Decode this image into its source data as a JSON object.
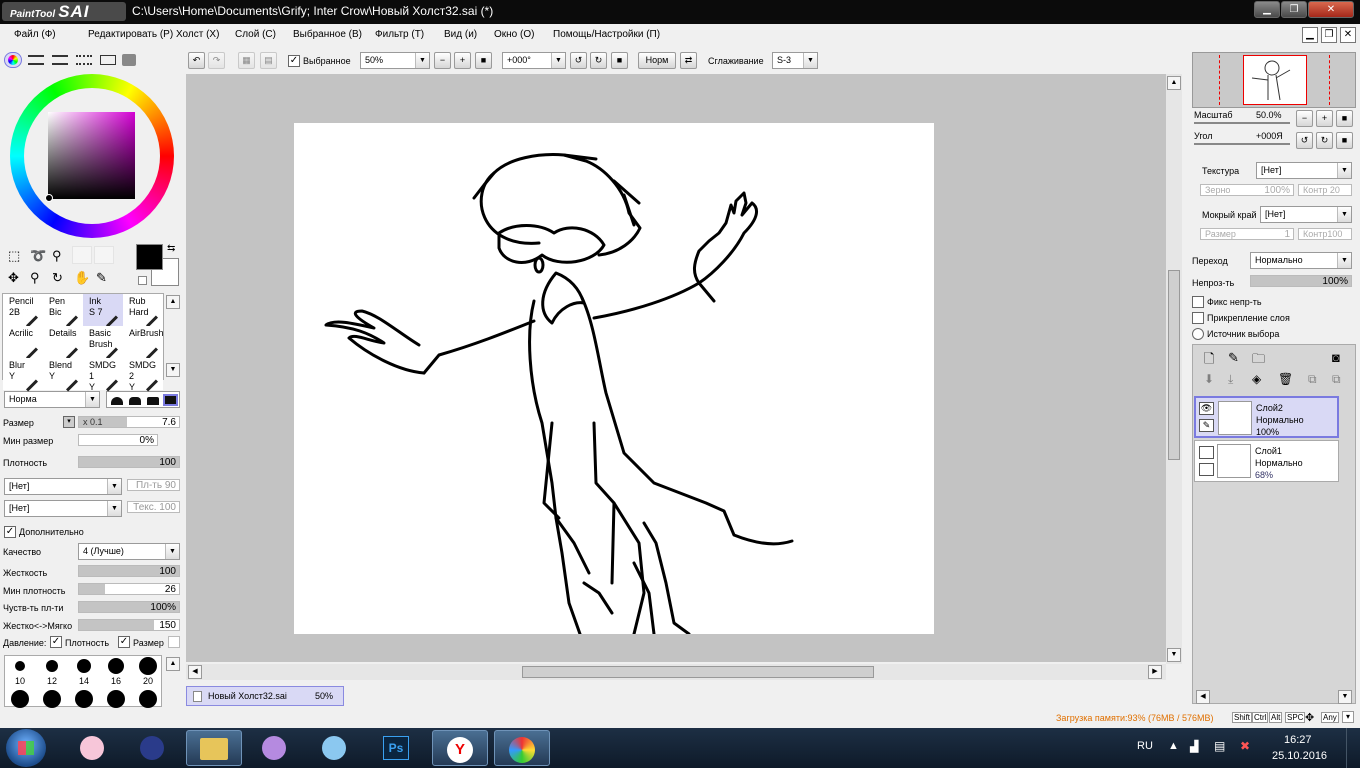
{
  "app": {
    "logo": "PaintTool SAI",
    "logo_small": "PaintTool",
    "logo_big": "SAI",
    "title": "C:\\Users\\Home\\Documents\\Grify; Inter Crow\\Новый Холст32.sai (*)"
  },
  "menu": [
    "Файл (Ф)",
    "Редактировать (Р)",
    "Холст (Х)",
    "Слой (С)",
    "Выбранное (В)",
    "Фильтр (Т)",
    "Вид (и)",
    "Окно (О)",
    "Помощь/Настройки (П)"
  ],
  "toolbar": {
    "selected_label": "Выбранное",
    "zoom": "50%",
    "angle": "+000°",
    "blend": "Норм",
    "smooth_label": "Сглаживание",
    "smooth_value": "S-3"
  },
  "colors": {
    "selected_color": "#000000",
    "secondary_color": "#ffffff",
    "accent": "#d9d9f5"
  },
  "tools": [
    {
      "line1": "Pencil",
      "line2": "2B"
    },
    {
      "line1": "Pen",
      "line2": "Bic"
    },
    {
      "line1": "Ink",
      "line2": "S 7"
    },
    {
      "line1": "Rub",
      "line2": "Hard"
    },
    {
      "line1": "Acrilic",
      "line2": ""
    },
    {
      "line1": "Details",
      "line2": ""
    },
    {
      "line1": "Basic",
      "line2": "Brush"
    },
    {
      "line1": "AirBrush",
      "line2": ""
    },
    {
      "line1": "Blur",
      "line2": "Y"
    },
    {
      "line1": "Blend",
      "line2": "Y"
    },
    {
      "line1": "SMDG 1",
      "line2": "Y"
    },
    {
      "line1": "SMDG 2",
      "line2": "Y"
    }
  ],
  "brush": {
    "mode": "Норма",
    "size_label": "Размер",
    "size_mult": "x 0.1",
    "size_value": "7.6",
    "min_size_label": "Мин размер",
    "min_size_value": "0%",
    "density_label": "Плотность",
    "density_value": "100",
    "tex1": "[Нет]",
    "tex1_side": "Пл-ть 90",
    "tex2": "[Нет]",
    "tex2_side": "Текс. 100",
    "advanced_label": "Дополнительно",
    "quality_label": "Качество",
    "quality_value": "4 (Лучше)",
    "hardness_label": "Жесткость",
    "hardness_value": "100",
    "min_density_label": "Мин плотность",
    "min_density_value": "26",
    "pressure_sense_label": "Чуств-ть пл-ти",
    "pressure_sense_value": "100%",
    "hard_soft_label": "Жестко<->Мягко",
    "hard_soft_value": "150",
    "pressure_label": "Давление:",
    "pressure_density": "Плотность",
    "pressure_size": "Размер"
  },
  "brush_sizes": [
    "10",
    "12",
    "14",
    "16",
    "20"
  ],
  "doc_tab": {
    "name": "Новый Холст32.sai",
    "zoom": "50%"
  },
  "navigator": {
    "zoom_label": "Масштаб",
    "zoom_value": "50.0%",
    "angle_label": "Угол",
    "angle_value": "+000Я"
  },
  "layer_props": {
    "texture_label": "Текстура",
    "texture_value": "[Нет]",
    "grain_label": "Зерно",
    "grain_value": "100%",
    "contrast_label": "Контр 20",
    "wet_label": "Мокрый край",
    "wet_value": "[Нет]",
    "wet_size_label": "Размер",
    "wet_size_value": "1",
    "wet_contrast_label": "Контр100",
    "blend_label": "Переход",
    "blend_value": "Нормально",
    "opacity_label": "Непроз-ть",
    "opacity_value": "100%",
    "fix_opacity": "Фикс непр-ть",
    "clip_layer": "Прикрепление слоя",
    "selection_source": "Источник выбора"
  },
  "layers": [
    {
      "name": "Слой2",
      "mode": "Нормально",
      "opacity": "100%",
      "selected": true
    },
    {
      "name": "Слой1",
      "mode": "Нормально",
      "opacity": "68%",
      "selected": false
    }
  ],
  "status": {
    "memory": "Загрузка памяти:93% (76MB / 576MB)",
    "keys": [
      "Shift",
      "Ctrl",
      "Alt",
      "SPC",
      "Any"
    ]
  },
  "taskbar": {
    "lang": "RU",
    "time": "16:27",
    "date": "25.10.2016"
  }
}
